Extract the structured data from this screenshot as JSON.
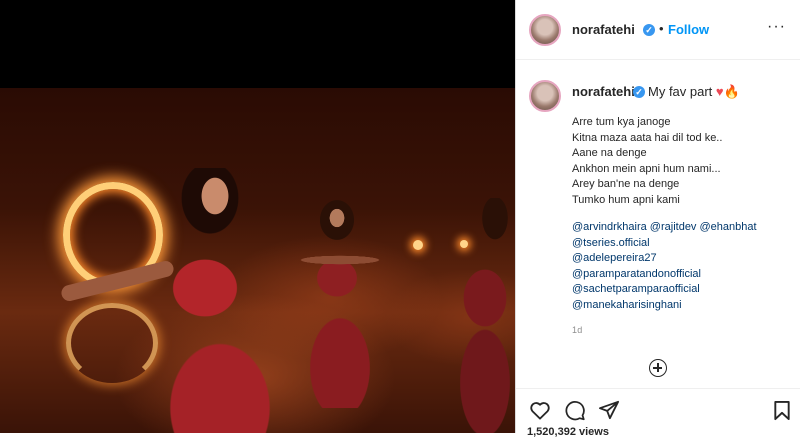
{
  "post": {
    "username": "norafatehi",
    "follow_label": "Follow",
    "more_label": "···",
    "caption_first": "My fav part",
    "lyrics": [
      "Arre tum kya janoge",
      "Kitna maza aata hai dil tod ke..",
      "Aane na denge",
      "Ankhon mein apni hum nami...",
      "Arey ban'ne na denge",
      "Tumko hum apni kami"
    ],
    "mentions": [
      "@arvindrkhaira @rajitdev @ehanbhat",
      "@tseries.official",
      "@adelepereira27",
      "@paramparatandonofficial",
      "@sachetparamparaofficial",
      "@manekaharisinghani"
    ],
    "time_ago": "1d",
    "likes_partial": "1,520,392 views"
  },
  "icons": [
    "verified-badge-icon",
    "heart-emoji-icon",
    "fire-emoji-icon",
    "add-comment-icon",
    "like-icon",
    "comment-icon",
    "share-icon",
    "save-icon"
  ],
  "colors": {
    "link": "#00376b",
    "follow": "#0095f6",
    "verified": "#3897f0",
    "heart": "#ed4956"
  }
}
